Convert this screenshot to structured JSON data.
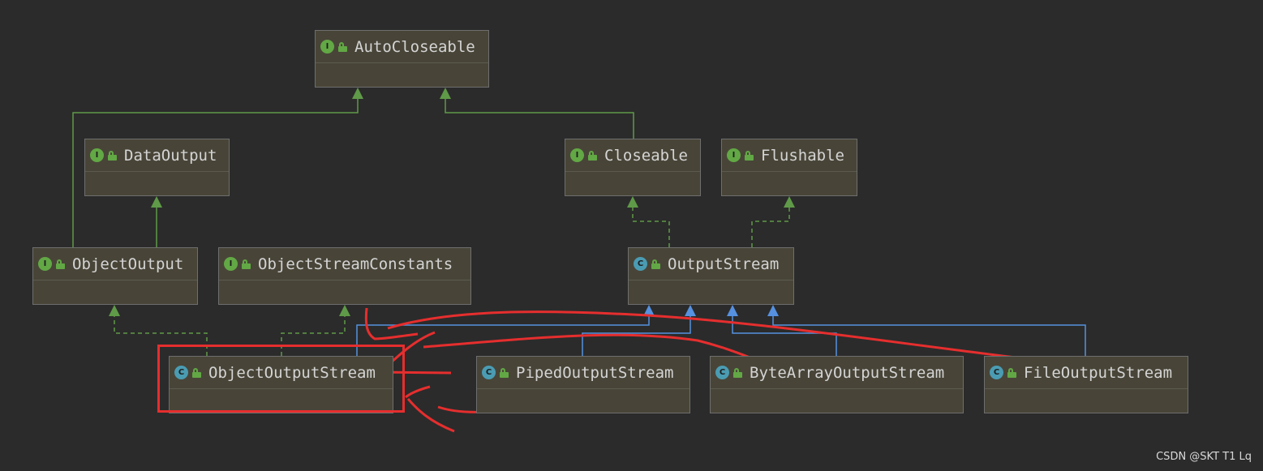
{
  "nodes": [
    {
      "id": "auto-closeable",
      "label": "AutoCloseable",
      "kind": "I"
    },
    {
      "id": "data-output",
      "label": "DataOutput",
      "kind": "I"
    },
    {
      "id": "closeable",
      "label": "Closeable",
      "kind": "I"
    },
    {
      "id": "flushable",
      "label": "Flushable",
      "kind": "I"
    },
    {
      "id": "object-output",
      "label": "ObjectOutput",
      "kind": "I"
    },
    {
      "id": "object-stream-constants",
      "label": "ObjectStreamConstants",
      "kind": "I"
    },
    {
      "id": "output-stream",
      "label": "OutputStream",
      "kind": "C"
    },
    {
      "id": "object-output-stream",
      "label": "ObjectOutputStream",
      "kind": "C"
    },
    {
      "id": "piped-output-stream",
      "label": "PipedOutputStream",
      "kind": "C"
    },
    {
      "id": "byte-array-output-stream",
      "label": "ByteArrayOutputStream",
      "kind": "C"
    },
    {
      "id": "file-output-stream",
      "label": "FileOutputStream",
      "kind": "C"
    }
  ],
  "relations": [
    {
      "from": "object-output",
      "to": "auto-closeable",
      "type": "extends"
    },
    {
      "from": "closeable",
      "to": "auto-closeable",
      "type": "extends"
    },
    {
      "from": "object-output",
      "to": "data-output",
      "type": "extends"
    },
    {
      "from": "output-stream",
      "to": "closeable",
      "type": "implements"
    },
    {
      "from": "output-stream",
      "to": "flushable",
      "type": "implements"
    },
    {
      "from": "object-output-stream",
      "to": "object-output",
      "type": "implements"
    },
    {
      "from": "object-output-stream",
      "to": "object-stream-constants",
      "type": "implements"
    },
    {
      "from": "object-output-stream",
      "to": "output-stream",
      "type": "class-extends"
    },
    {
      "from": "piped-output-stream",
      "to": "output-stream",
      "type": "class-extends"
    },
    {
      "from": "byte-array-output-stream",
      "to": "output-stream",
      "type": "class-extends"
    },
    {
      "from": "file-output-stream",
      "to": "output-stream",
      "type": "class-extends"
    }
  ],
  "highlight": {
    "node": "object-output-stream",
    "color": "#e62e2e"
  },
  "colors": {
    "interface_edge": "#5f9a48",
    "class_edge": "#5591e0",
    "annotation": "#e62e2e",
    "node_fill": "#484538",
    "background": "#2b2b2b"
  },
  "watermark": "CSDN @SKT T1 Lq"
}
